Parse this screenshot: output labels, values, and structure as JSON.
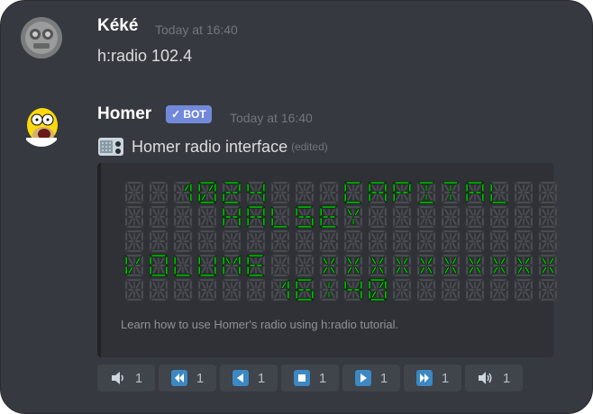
{
  "messages": [
    {
      "author": "Kéké",
      "timestamp": "Today at 16:40",
      "content": "h:radio 102.4"
    },
    {
      "author": "Homer",
      "badge": "✓ BOT",
      "timestamp": "Today at 16:40",
      "content": "Homer radio interface",
      "edited": "(edited)"
    }
  ],
  "embed": {
    "lcd_rows": [
      "  1024   CAPITAL  ",
      "    HALSEY        ",
      "                  ",
      "VOLUME  XXXXXXXXXX",
      "      16:40       "
    ],
    "lcd_color": "#00d400",
    "lcd_dim_color": "#4f5257",
    "footer": "Learn how to use Homer's radio using h:radio tutorial."
  },
  "buttons": [
    {
      "icon": "volume-down-icon",
      "count": "1"
    },
    {
      "icon": "rewind-icon",
      "count": "1"
    },
    {
      "icon": "previous-icon",
      "count": "1"
    },
    {
      "icon": "stop-icon",
      "count": "1"
    },
    {
      "icon": "play-icon",
      "count": "1"
    },
    {
      "icon": "fast-forward-icon",
      "count": "1"
    },
    {
      "icon": "volume-up-icon",
      "count": "1"
    }
  ]
}
